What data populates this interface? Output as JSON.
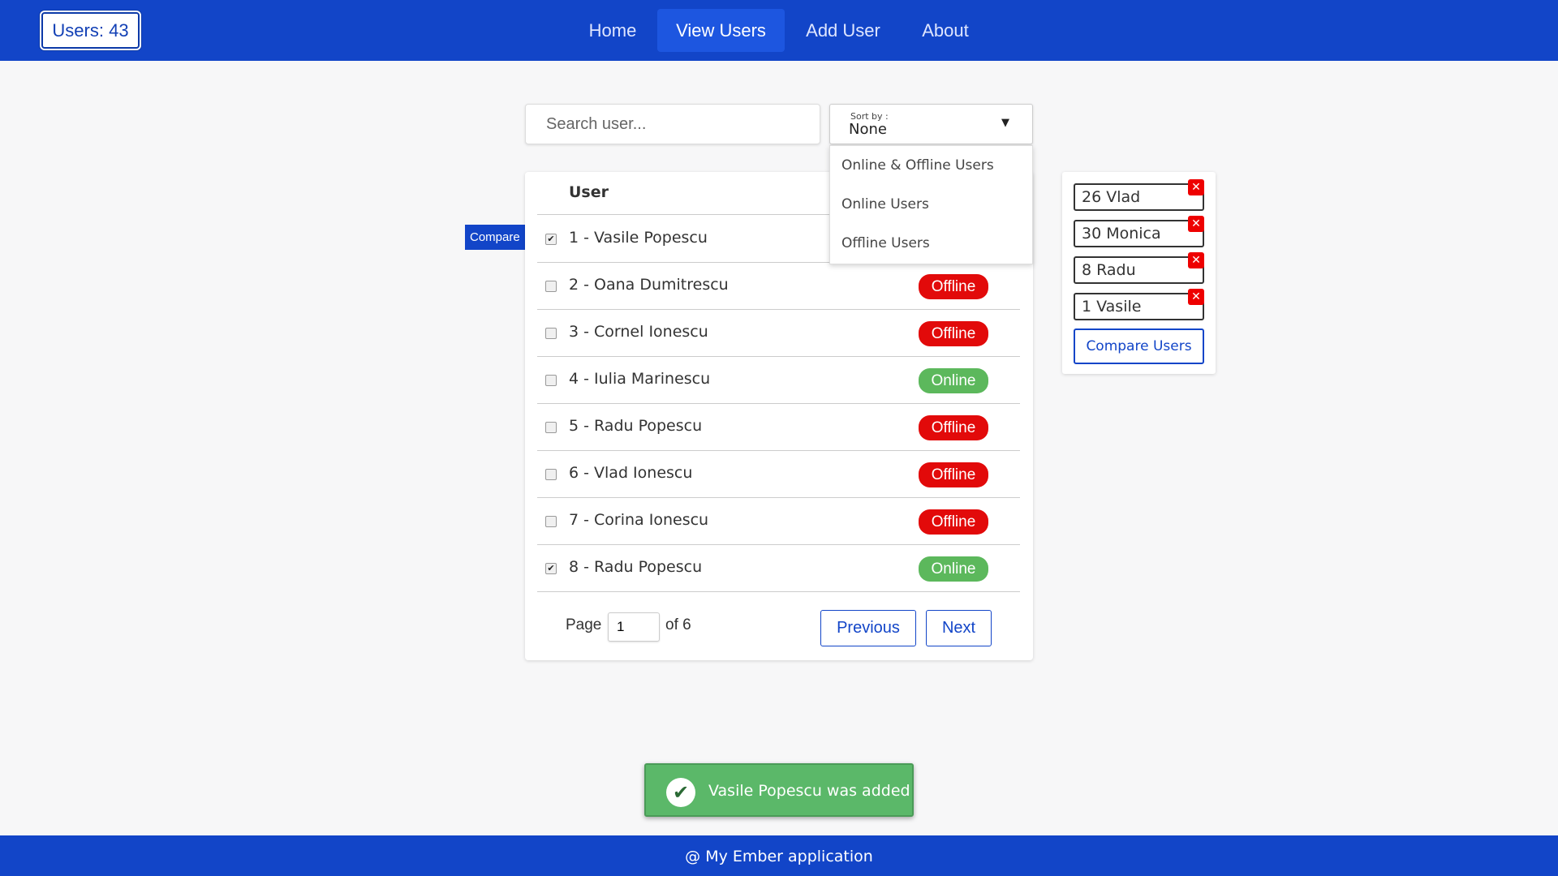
{
  "header": {
    "user_count": "Users: 43",
    "nav": [
      {
        "label": "Home",
        "active": false
      },
      {
        "label": "View Users",
        "active": true
      },
      {
        "label": "Add User",
        "active": false
      },
      {
        "label": "About",
        "active": false
      }
    ]
  },
  "search": {
    "placeholder": "Search user..."
  },
  "sort": {
    "label": "Sort by :",
    "value": "None",
    "options": [
      "Online & Offline Users",
      "Online Users",
      "Offline Users"
    ]
  },
  "table": {
    "header_user": "User",
    "rows": [
      {
        "name": "1 - Vasile Popescu",
        "checked": true,
        "status": ""
      },
      {
        "name": "2 - Oana Dumitrescu",
        "checked": false,
        "status": "Offline"
      },
      {
        "name": "3 - Cornel Ionescu",
        "checked": false,
        "status": "Offline"
      },
      {
        "name": "4 - Iulia Marinescu",
        "checked": false,
        "status": "Online"
      },
      {
        "name": "5 - Radu Popescu",
        "checked": false,
        "status": "Offline"
      },
      {
        "name": "6 - Vlad Ionescu",
        "checked": false,
        "status": "Offline"
      },
      {
        "name": "7 - Corina Ionescu",
        "checked": false,
        "status": "Offline"
      },
      {
        "name": "8 - Radu Popescu",
        "checked": true,
        "status": "Online"
      }
    ],
    "status_colors": {
      "Online": "#5cb85c",
      "Offline": "#e20a0a"
    }
  },
  "compare_tag": "Compare",
  "pagination": {
    "page_label": "Page",
    "page_value": "1",
    "of_label": "of 6",
    "previous": "Previous",
    "next": "Next"
  },
  "compare_panel": {
    "selected": [
      "26 Vlad",
      "30 Monica",
      "8 Radu",
      "1 Vasile"
    ],
    "remove_icon": "close-icon",
    "button": "Compare Users"
  },
  "toast": {
    "message": "Vasile Popescu was added",
    "icon": "check-icon"
  },
  "footer": {
    "text": "@ My Ember application"
  },
  "colors": {
    "primary": "#1245c8",
    "success": "#5bb869",
    "danger": "#e20a0a"
  }
}
